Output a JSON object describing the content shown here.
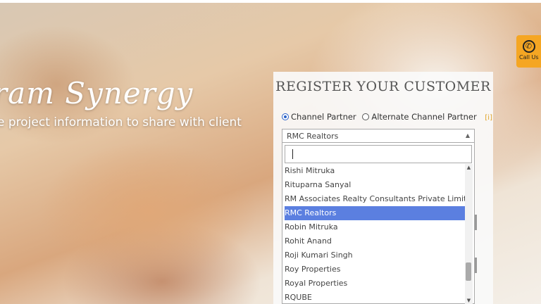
{
  "hero": {
    "title": "ram Synergy",
    "subtitle": "e project information to share with client"
  },
  "call_button": {
    "label": "Call Us",
    "icon": "phone-icon"
  },
  "form": {
    "title": "REGISTER YOUR CUSTOMER",
    "radio_channel_partner": "Channel Partner",
    "radio_alternate": "Alternate Channel Partner",
    "info_marker": "[i]",
    "selected_value": "RMC Realtors",
    "search_value": ""
  },
  "dropdown": {
    "options": [
      "Rishi Mitruka",
      "Rituparna Sanyal",
      "RM Associates Realty Consultants Private Limited",
      "RMC Realtors",
      "Robin Mitruka",
      "Rohit Anand",
      "Roji Kumari Singh",
      "Roy Properties",
      "Royal Properties",
      "RQUBE"
    ],
    "highlighted": "RMC Realtors"
  },
  "colors": {
    "accent": "#f5a623",
    "highlight": "#5b7fe0",
    "radio": "#2a62c9"
  }
}
